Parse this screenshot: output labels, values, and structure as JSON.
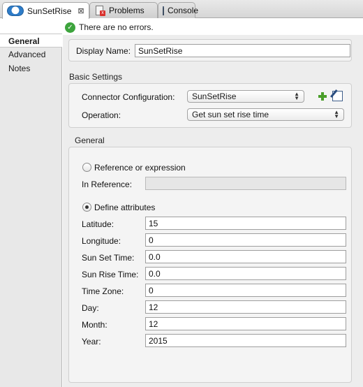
{
  "tabs": {
    "editor_label": "SunSetRise",
    "close_glyph": "⊠",
    "problems_label": "Problems",
    "console_label": "Console"
  },
  "status": {
    "message": "There are no errors."
  },
  "nav": {
    "items": [
      "General",
      "Advanced",
      "Notes"
    ]
  },
  "display_name": {
    "label": "Display Name:",
    "value": "SunSetRise"
  },
  "basic_settings": {
    "title": "Basic Settings",
    "connector_label": "Connector Configuration:",
    "connector_value": "SunSetRise",
    "operation_label": "Operation:",
    "operation_value": "Get sun set rise time"
  },
  "general": {
    "title": "General",
    "ref_radio_label": "Reference or expression",
    "in_reference_label": "In Reference:",
    "in_reference_value": "",
    "define_radio_label": "Define attributes",
    "fields": [
      {
        "label": "Latitude:",
        "value": "15"
      },
      {
        "label": "Longitude:",
        "value": "0"
      },
      {
        "label": "Sun Set Time:",
        "value": "0.0"
      },
      {
        "label": "Sun Rise Time:",
        "value": "0.0"
      },
      {
        "label": "Time Zone:",
        "value": "0"
      },
      {
        "label": "Day:",
        "value": "12"
      },
      {
        "label": "Month:",
        "value": "12"
      },
      {
        "label": "Year:",
        "value": "2015"
      }
    ]
  },
  "colors": {
    "ok": "#3da43d",
    "add": "#4a9e2a",
    "cloud": "#2e7cc8"
  }
}
